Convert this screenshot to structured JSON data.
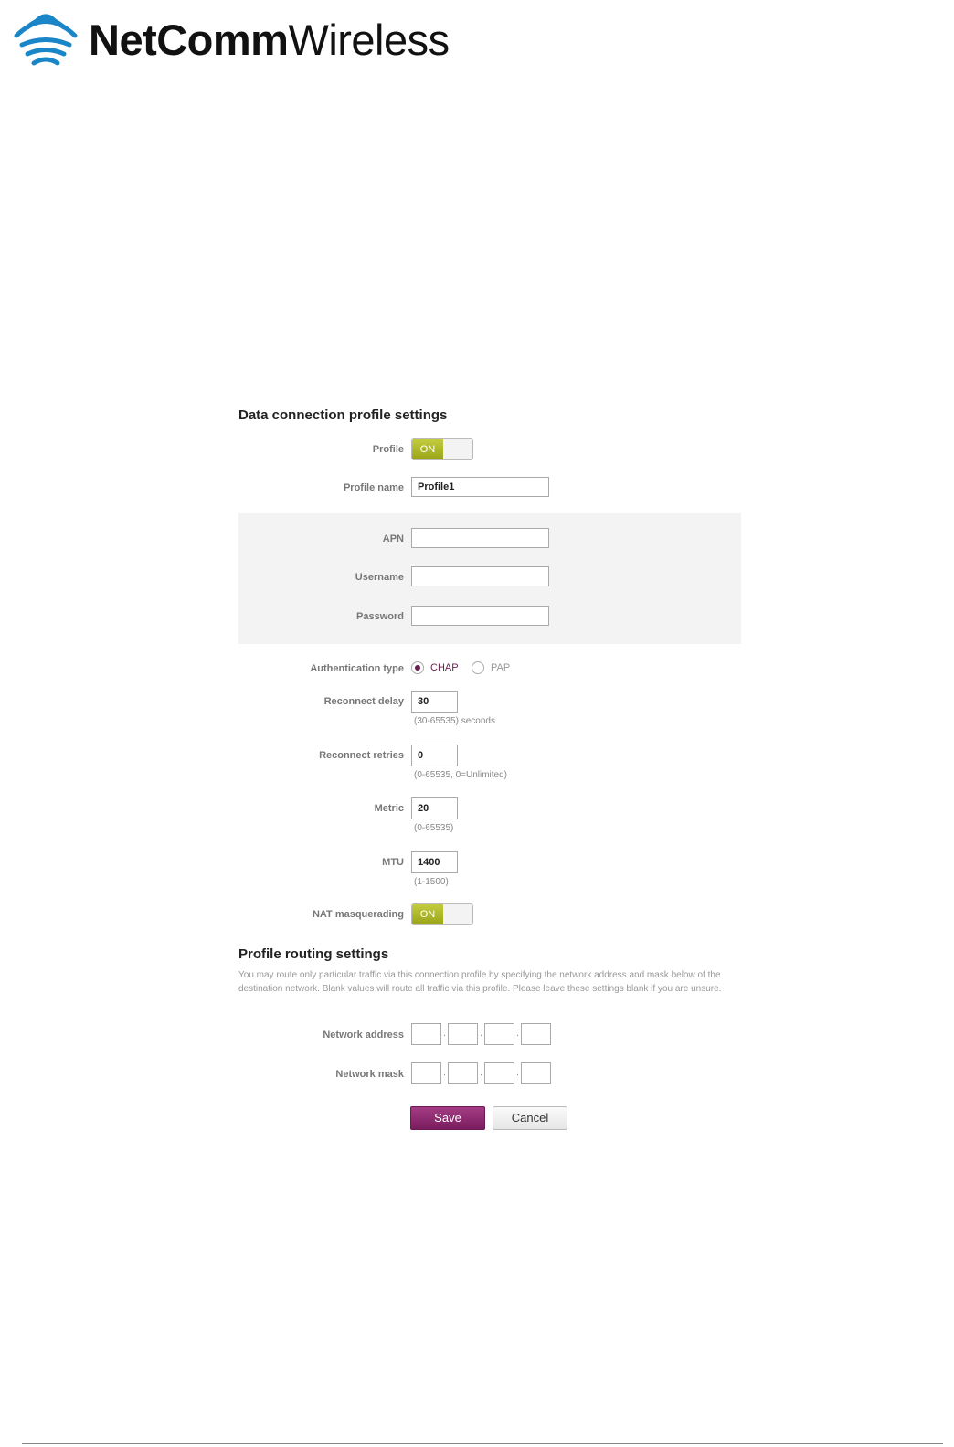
{
  "brand": {
    "name_bold": "NetComm",
    "name_light": "Wireless"
  },
  "profile_section": {
    "title": "Data connection profile settings",
    "profile_label": "Profile",
    "profile_toggle": "ON",
    "profile_name_label": "Profile name",
    "profile_name_value": "Profile1",
    "apn_label": "APN",
    "apn_value": "",
    "username_label": "Username",
    "username_value": "",
    "password_label": "Password",
    "password_value": "",
    "auth_label": "Authentication type",
    "auth_options": [
      "CHAP",
      "PAP"
    ],
    "auth_selected": "CHAP",
    "reconnect_delay_label": "Reconnect delay",
    "reconnect_delay_value": "30",
    "reconnect_delay_hint": "(30-65535) seconds",
    "reconnect_retries_label": "Reconnect retries",
    "reconnect_retries_value": "0",
    "reconnect_retries_hint": "(0-65535, 0=Unlimited)",
    "metric_label": "Metric",
    "metric_value": "20",
    "metric_hint": "(0-65535)",
    "mtu_label": "MTU",
    "mtu_value": "1400",
    "mtu_hint": "(1-1500)",
    "nat_label": "NAT masquerading",
    "nat_toggle": "ON"
  },
  "routing_section": {
    "title": "Profile routing settings",
    "description": "You may route only particular traffic via this connection profile by specifying the network address and mask below of the destination network. Blank values will route all traffic via this profile. Please leave these settings blank if you are unsure.",
    "network_address_label": "Network address",
    "network_mask_label": "Network mask",
    "ip_separator": "."
  },
  "actions": {
    "save_label": "Save",
    "cancel_label": "Cancel"
  },
  "colors": {
    "toggle_on": "#a9b32a",
    "save_button": "#8a2a6e",
    "radio_selected": "#6b1f4f",
    "logo_blue": "#1a86c8"
  }
}
